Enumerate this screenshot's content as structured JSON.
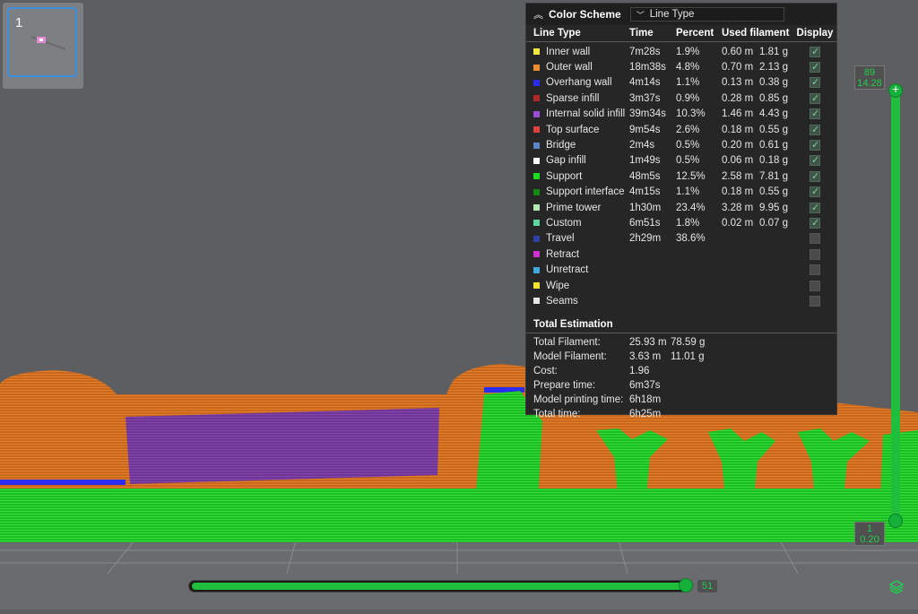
{
  "plate": {
    "number": "1"
  },
  "panel": {
    "title": "Color Scheme",
    "scheme": "Line Type",
    "headers": {
      "type": "Line Type",
      "time": "Time",
      "percent": "Percent",
      "used": "Used filament",
      "display": "Display"
    },
    "rows": [
      {
        "name": "Inner wall",
        "color": "#f2e93a",
        "time": "7m28s",
        "pct": "1.9%",
        "len": "0.60 m",
        "g": "1.81 g",
        "display": "on"
      },
      {
        "name": "Outer wall",
        "color": "#f08b2c",
        "time": "18m38s",
        "pct": "4.8%",
        "len": "0.70 m",
        "g": "2.13 g",
        "display": "on"
      },
      {
        "name": "Overhang wall",
        "color": "#2a2cf0",
        "time": "4m14s",
        "pct": "1.1%",
        "len": "0.13 m",
        "g": "0.38 g",
        "display": "on"
      },
      {
        "name": "Sparse infill",
        "color": "#b02828",
        "time": "3m37s",
        "pct": "0.9%",
        "len": "0.28 m",
        "g": "0.85 g",
        "display": "on"
      },
      {
        "name": "Internal solid infill",
        "color": "#9a4ed8",
        "time": "39m34s",
        "pct": "10.3%",
        "len": "1.46 m",
        "g": "4.43 g",
        "display": "on"
      },
      {
        "name": "Top surface",
        "color": "#e04040",
        "time": "9m54s",
        "pct": "2.6%",
        "len": "0.18 m",
        "g": "0.55 g",
        "display": "on"
      },
      {
        "name": "Bridge",
        "color": "#5b86c6",
        "time": "2m4s",
        "pct": "0.5%",
        "len": "0.20 m",
        "g": "0.61 g",
        "display": "on"
      },
      {
        "name": "Gap infill",
        "color": "#ffffff",
        "time": "1m49s",
        "pct": "0.5%",
        "len": "0.06 m",
        "g": "0.18 g",
        "display": "on"
      },
      {
        "name": "Support",
        "color": "#1de01d",
        "time": "48m5s",
        "pct": "12.5%",
        "len": "2.58 m",
        "g": "7.81 g",
        "display": "on"
      },
      {
        "name": "Support interface",
        "color": "#138a13",
        "time": "4m15s",
        "pct": "1.1%",
        "len": "0.18 m",
        "g": "0.55 g",
        "display": "on"
      },
      {
        "name": "Prime tower",
        "color": "#b3e6b3",
        "time": "1h30m",
        "pct": "23.4%",
        "len": "3.28 m",
        "g": "9.95 g",
        "display": "on"
      },
      {
        "name": "Custom",
        "color": "#5ed6a0",
        "time": "6m51s",
        "pct": "1.8%",
        "len": "0.02 m",
        "g": "0.07 g",
        "display": "on"
      },
      {
        "name": "Travel",
        "color": "#2e3fa8",
        "time": "2h29m",
        "pct": "38.6%",
        "len": "",
        "g": "",
        "display": "off"
      },
      {
        "name": "Retract",
        "color": "#d22fd2",
        "time": "",
        "pct": "",
        "len": "",
        "g": "",
        "display": "off"
      },
      {
        "name": "Unretract",
        "color": "#3fa8e0",
        "time": "",
        "pct": "",
        "len": "",
        "g": "",
        "display": "off"
      },
      {
        "name": "Wipe",
        "color": "#f5e52a",
        "time": "",
        "pct": "",
        "len": "",
        "g": "",
        "display": "off"
      },
      {
        "name": "Seams",
        "color": "#e6e6e6",
        "time": "",
        "pct": "",
        "len": "",
        "g": "",
        "display": "off"
      }
    ],
    "estimation": {
      "title": "Total Estimation",
      "rows": [
        {
          "label": "Total Filament:",
          "v1": "25.93 m",
          "v2": "78.59 g"
        },
        {
          "label": "Model Filament:",
          "v1": "3.63 m",
          "v2": "11.01 g"
        },
        {
          "label": "Cost:",
          "v1": "1.96",
          "v2": ""
        },
        {
          "label": "Prepare time:",
          "v1": "6m37s",
          "v2": ""
        },
        {
          "label": "Model printing time:",
          "v1": "6h18m",
          "v2": ""
        },
        {
          "label": "Total time:",
          "v1": "6h25m",
          "v2": ""
        }
      ]
    }
  },
  "layer_slider": {
    "top_layer": "89",
    "top_height": "14.28",
    "bottom_layer": "1",
    "bottom_height": "0.20"
  },
  "move_slider": {
    "value": "51"
  },
  "colors": {
    "accent": "#1fbf3d",
    "support": "#1de01d",
    "outer_wall": "#f08b2c",
    "solid_infill": "#7a3aa0",
    "overhang": "#2a2cf0"
  }
}
